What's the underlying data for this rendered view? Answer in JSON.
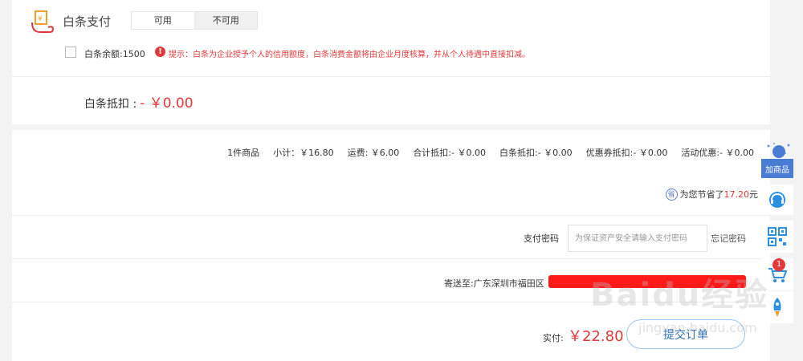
{
  "baitiao": {
    "title": "白条支付",
    "options": [
      "可用",
      "不可用"
    ],
    "balance": "白条余额:1500",
    "tip": "提示：白条为企业授予个人的信用额度，白条消费金额将由企业月度核算，并从个人待遇中直接扣减。",
    "deduct_label": "白条抵扣 :",
    "deduct_amount": "- ￥0.00"
  },
  "summary": {
    "items": [
      "1件商品",
      "小计：￥16.80",
      "运费: ￥6.00",
      "合计抵扣:- ￥0.00",
      "白条抵扣:- ￥0.00",
      "优惠券抵扣:- ￥0.00",
      "活动优惠:- ￥0.00"
    ],
    "savings_icon": "省",
    "savings_label": "为您节省了",
    "savings_amount": "17.20",
    "savings_unit": "元"
  },
  "payment": {
    "password_label": "支付密码",
    "password_placeholder": "为保证资产安全请输入支付密码",
    "forgot": "忘记密码"
  },
  "shipping": {
    "label": "寄送至:广东深圳市福田区"
  },
  "total": {
    "label": "实付:",
    "amount": "￥22.80",
    "submit": "提交订单"
  },
  "sidebar": {
    "add_label": "加商品",
    "cart_count": "1"
  },
  "watermark": {
    "main": "Baidu经验",
    "sub": "jingyan.baidu.com"
  },
  "colors": {
    "accent_red": "#e4393c",
    "brand_blue": "#4a7cd3"
  }
}
